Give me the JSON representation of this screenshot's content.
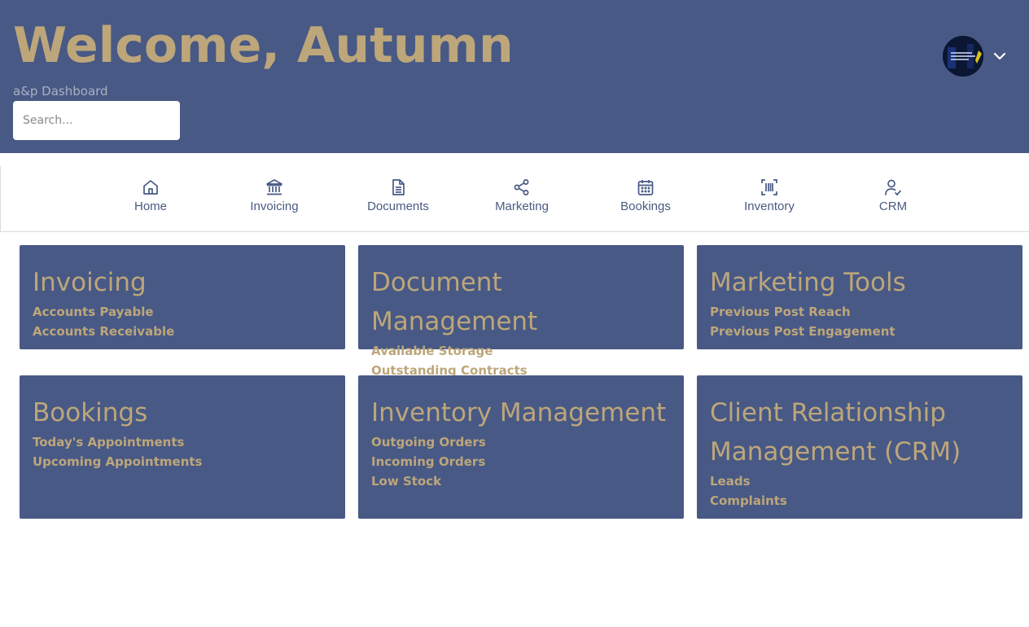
{
  "header": {
    "welcome": "Welcome, Autumn",
    "subtitle": "a&p Dashboard",
    "search_placeholder": "Search..."
  },
  "nav": [
    {
      "label": "Home",
      "icon": "home-icon"
    },
    {
      "label": "Invoicing",
      "icon": "bank-icon"
    },
    {
      "label": "Documents",
      "icon": "document-icon"
    },
    {
      "label": "Marketing",
      "icon": "share-icon"
    },
    {
      "label": "Bookings",
      "icon": "calendar-icon"
    },
    {
      "label": "Inventory",
      "icon": "barcode-scan-icon"
    },
    {
      "label": "CRM",
      "icon": "user-check-icon"
    }
  ],
  "cards": [
    {
      "title": "Invoicing",
      "lines": [
        "Accounts Payable",
        "Accounts Receivable"
      ]
    },
    {
      "title": "Document Management",
      "lines": [
        "Available Storage",
        "Outstanding Contracts"
      ]
    },
    {
      "title": "Marketing Tools",
      "lines": [
        "Previous Post Reach",
        "Previous Post Engagement"
      ]
    },
    {
      "title": "Bookings",
      "lines": [
        "Today's Appointments",
        "Upcoming Appointments"
      ]
    },
    {
      "title": "Inventory Management",
      "lines": [
        "Outgoing Orders",
        "Incoming Orders",
        "Low Stock"
      ]
    },
    {
      "title": "Client Relationship Management (CRM)",
      "lines": [
        "Leads",
        "Complaints"
      ]
    }
  ],
  "colors": {
    "primary": "#485985",
    "accent": "#bda67a",
    "nav_text": "#495a80"
  }
}
